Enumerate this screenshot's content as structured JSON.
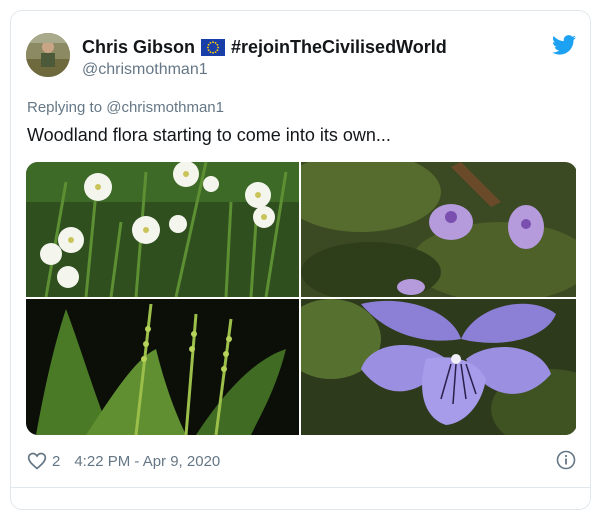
{
  "author": {
    "display_name": "Chris Gibson",
    "flag_icon": "eu-flag-icon",
    "name_suffix": "#rejoinTheCivilisedWorld",
    "handle": "@chrismothman1"
  },
  "reply": {
    "prefix": "Replying to",
    "handle": "@chrismothman1"
  },
  "tweet": {
    "text": "Woodland flora starting to come into its own..."
  },
  "media": [
    {
      "icon": "white-stitchwort-flowers-photo"
    },
    {
      "icon": "small-violet-flowers-photo"
    },
    {
      "icon": "green-flower-spikes-photo"
    },
    {
      "icon": "violet-closeup-photo"
    }
  ],
  "footer": {
    "like_count": "2",
    "timestamp": "4:22 PM - Apr 9, 2020"
  },
  "colors": {
    "twitter_blue": "#1da1f2",
    "text_primary": "#14171a",
    "text_secondary": "#657786",
    "border": "#e1e8ed"
  }
}
